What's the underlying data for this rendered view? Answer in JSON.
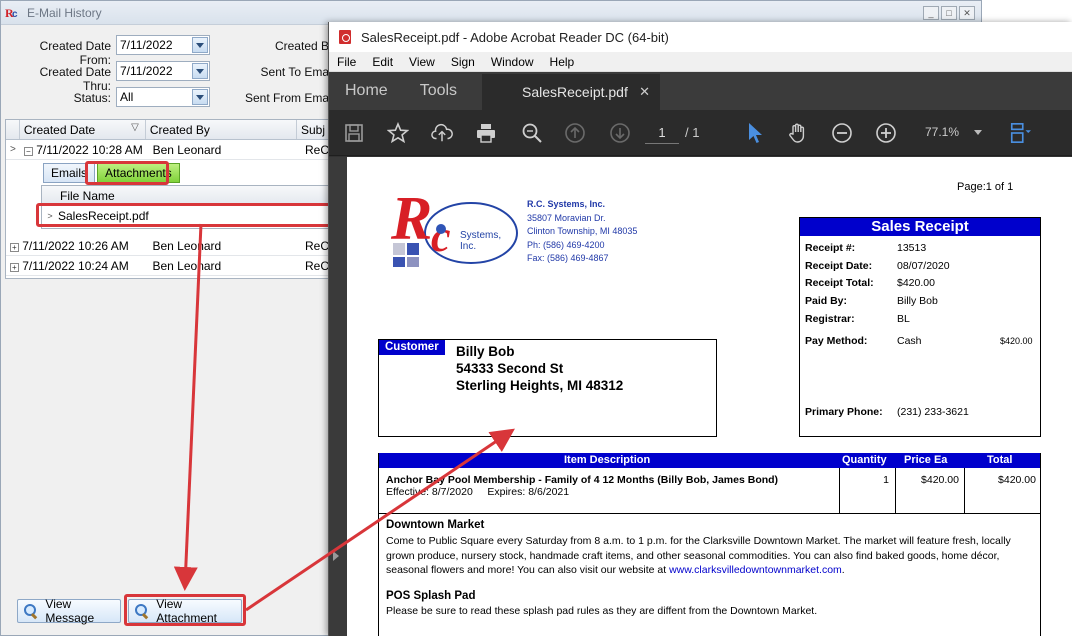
{
  "email_history": {
    "title": "E-Mail History",
    "filters": {
      "created_date_from_label": "Created Date From:",
      "created_date_from_value": "7/11/2022",
      "created_date_thru_label": "Created Date Thru:",
      "created_date_thru_value": "7/11/2022",
      "status_label": "Status:",
      "status_value": "All",
      "created_by_label": "Created B",
      "sent_to_label": "Sent To Ema",
      "sent_from_label": "Sent From Ema"
    },
    "grid": {
      "columns": [
        "Created Date",
        "Created By",
        "Subj"
      ],
      "rows": [
        {
          "date": "7/11/2022 10:28 AM",
          "by": "Ben Leonard",
          "subj": "ReC"
        },
        {
          "date": "7/11/2022 10:26 AM",
          "by": "Ben Leonard",
          "subj": "ReC"
        },
        {
          "date": "7/11/2022 10:24 AM",
          "by": "Ben Leonard",
          "subj": "ReC"
        }
      ],
      "tabs": [
        "Emails",
        "Attachments"
      ],
      "sub_header": "File Name",
      "sub_row": "SalesReceipt.pdf"
    },
    "buttons": {
      "view_message": "View Message",
      "view_attachment": "View Attachment"
    }
  },
  "acrobat": {
    "title": "SalesReceipt.pdf - Adobe Acrobat Reader DC (64-bit)",
    "menu": [
      "File",
      "Edit",
      "View",
      "Sign",
      "Window",
      "Help"
    ],
    "nav": {
      "home": "Home",
      "tools": "Tools"
    },
    "doc_tab": "SalesReceipt.pdf",
    "page_current": "1",
    "page_total": "/ 1",
    "zoom": "77.1%"
  },
  "receipt": {
    "page_label": "Page:1 of 1",
    "company": {
      "name": "R.C. Systems, Inc.",
      "address1": "35807 Moravian Dr.",
      "address2": "Clinton Township, MI 48035",
      "phone": "Ph: (586) 469-4200",
      "fax": "Fax: (586) 469-4867",
      "logo_text": "Systems, Inc."
    },
    "sales_receipt": {
      "title": "Sales Receipt",
      "receipt_no_label": "Receipt #:",
      "receipt_no": "13513",
      "receipt_date_label": "Receipt Date:",
      "receipt_date": "08/07/2020",
      "receipt_total_label": "Receipt Total:",
      "receipt_total": "$420.00",
      "paid_by_label": "Paid By:",
      "paid_by": "Billy Bob",
      "registrar_label": "Registrar:",
      "registrar": "BL",
      "pay_method_label": "Pay Method:",
      "pay_method": "Cash",
      "pay_amount": "$420.00",
      "primary_phone_label": "Primary Phone:",
      "primary_phone": "(231) 233-3621"
    },
    "customer": {
      "label": "Customer",
      "name": "Billy Bob",
      "street": "54333 Second St",
      "city": "Sterling Heights, MI  48312"
    },
    "items": {
      "headers": {
        "description": "Item Description",
        "quantity": "Quantity",
        "price": "Price Ea",
        "total": "Total"
      },
      "row1": {
        "description": "Anchor Bay Pool Membership - Family of 4 12 Months (Billy Bob, James Bond)",
        "dates": "Effective: 8/7/2020     Expires: 8/6/2021",
        "quantity": "1",
        "price": "$420.00",
        "total": "$420.00"
      },
      "block1_title": "Downtown  Market",
      "block1_text": "Come to Public Square every Saturday from 8 a.m. to 1 p.m. for the Clarksville Downtown Market. The market will feature fresh, locally grown produce, nursery stock, handmade craft items, and other seasonal commodities. You can also find baked goods, home décor, seasonal flowers and more! You can also visit our website at ",
      "block1_link": "www.clarksvilledowntownmarket.com",
      "block1_end": ".",
      "block2_title": "POS Splash Pad",
      "block2_text": "Please be sure to read these splash pad rules as they are diffent from the Downtown Market."
    }
  }
}
